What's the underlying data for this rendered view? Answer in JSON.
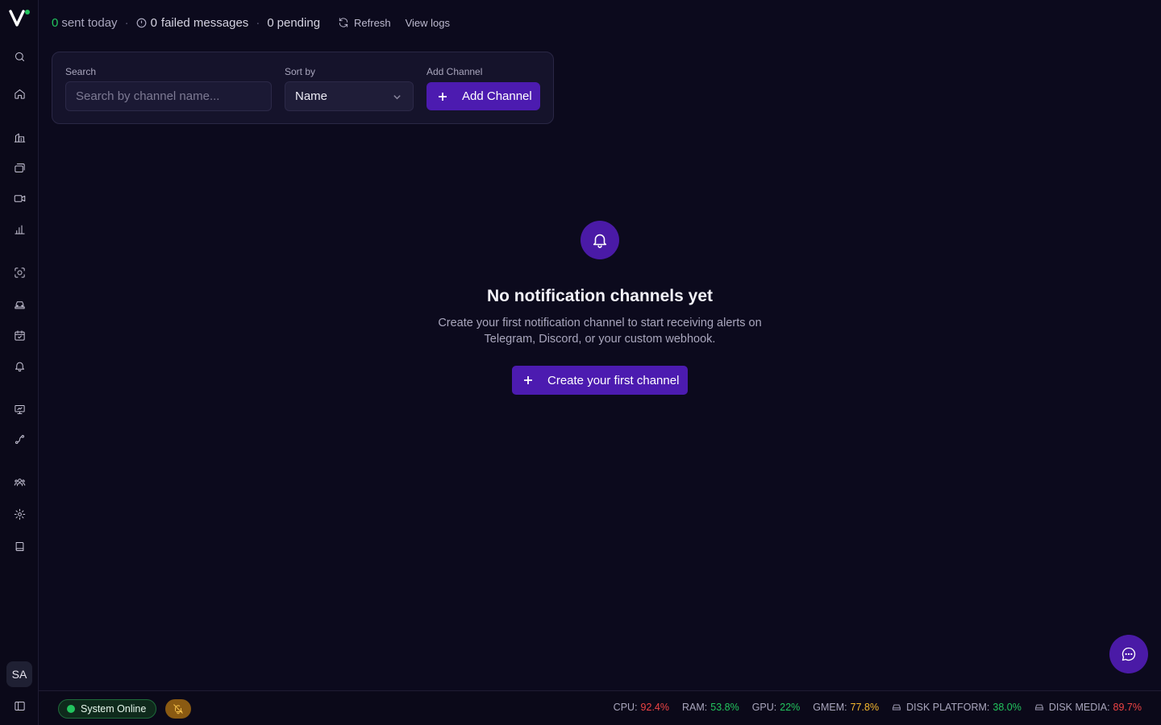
{
  "stats": {
    "sent_count": "0",
    "sent_label": "sent today",
    "failed_count": "0",
    "failed_label": "failed messages",
    "pending_count": "0",
    "pending_label": "pending",
    "separator": "·",
    "refresh_label": "Refresh",
    "view_logs_label": "View logs"
  },
  "filters": {
    "search_label": "Search",
    "search_placeholder": "Search by channel name...",
    "sort_label": "Sort by",
    "sort_value": "Name",
    "add_label": "Add Channel",
    "add_button": "Add Channel"
  },
  "empty_state": {
    "icon": "bell-icon",
    "title": "No notification channels yet",
    "description": "Create your first notification channel to start receiving alerts on Telegram, Discord, or your custom webhook.",
    "button": "Create your first channel"
  },
  "sidebar": {
    "avatar_initials": "SA",
    "icons": [
      "search-icon",
      "home-icon",
      "buildings-icon",
      "layers-icon",
      "video-icon",
      "chart-icon",
      "scan-face-icon",
      "car-icon",
      "calendar-check-icon",
      "bell-icon",
      "presentation-icon",
      "route-icon",
      "users-icon",
      "gear-icon",
      "book-icon"
    ]
  },
  "statusbar": {
    "online_label": "System Online",
    "cpu_label": "CPU:",
    "cpu_value": "92.4%",
    "ram_label": "RAM:",
    "ram_value": "53.8%",
    "gpu_label": "GPU:",
    "gpu_value": "22%",
    "gmem_label": "GMEM:",
    "gmem_value": "77.8%",
    "disk_platform_label": "DISK PLATFORM:",
    "disk_platform_value": "38.0%",
    "disk_media_label": "DISK MEDIA:",
    "disk_media_value": "89.7%"
  },
  "colors": {
    "accent": "#4c1bb0",
    "success": "#22c55e",
    "danger": "#ef4444",
    "warning": "#f5b82e",
    "background": "#0c0a1d"
  }
}
